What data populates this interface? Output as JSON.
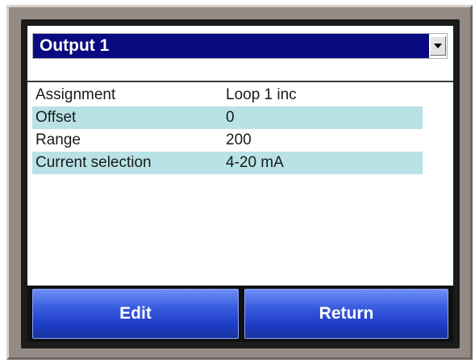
{
  "dropdown": {
    "selected": "Output 1",
    "arrow_icon": "chevron-down-icon"
  },
  "table": {
    "rows": [
      {
        "label": "Assignment",
        "value": "Loop 1 inc"
      },
      {
        "label": "Offset",
        "value": "0"
      },
      {
        "label": "Range",
        "value": "200"
      },
      {
        "label": "Current selection",
        "value": "4-20 mA"
      }
    ]
  },
  "buttons": {
    "edit_label": "Edit",
    "return_label": "Return"
  },
  "colors": {
    "header_bg": "#0a0a80",
    "alt_row_bg": "#b9e2e6",
    "button_blue": "#2a4ad4",
    "bezel": "#948b87"
  }
}
